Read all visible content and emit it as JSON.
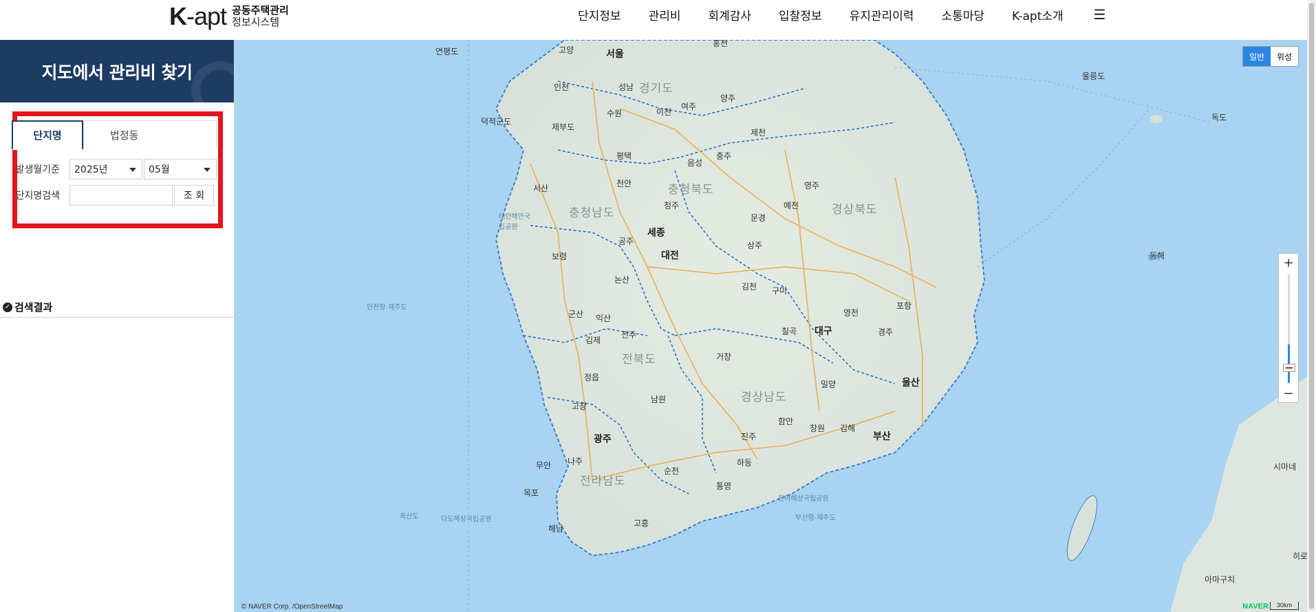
{
  "header": {
    "logo_mark_bold": "K",
    "logo_mark_rest": "-apt",
    "logo_line1": "공동주택관리",
    "logo_line2": "정보시스템",
    "nav": [
      "단지정보",
      "관리비",
      "회계감사",
      "입찰정보",
      "유지관리이력",
      "소통마당",
      "K-apt소개"
    ],
    "menu_icon": "hamburger-icon",
    "menu_glyph": "☰"
  },
  "panel": {
    "title": "지도에서 관리비 찾기",
    "tabs": {
      "active": "단지명",
      "inactive": "법정동"
    },
    "date_label": "발생월기준",
    "year_value": "2025년",
    "month_value": "05월",
    "name_label": "단지명검색",
    "name_value": "",
    "search_button": "조 회",
    "results_label": "검색결과",
    "highlight_color": "#e3161f"
  },
  "map": {
    "type_toggle": {
      "normal": "일반",
      "satellite": "위성"
    },
    "zoom_in": "+",
    "zoom_out": "−",
    "copyright": "© NAVER Corp. /OpenStreetMap",
    "provider": "NAVER",
    "scale": "30km",
    "provinces": [
      "경기도",
      "충청북도",
      "충청남도",
      "경상북도",
      "전북도",
      "경상남도",
      "전라남도"
    ],
    "cities_major": [
      "서울",
      "세종",
      "대전",
      "대구",
      "울산",
      "부산",
      "광주"
    ],
    "cities": [
      "홍천",
      "연평도",
      "고양",
      "인천",
      "성남",
      "수원",
      "이천",
      "여주",
      "양주",
      "덕적군도",
      "제부도",
      "제천",
      "평택",
      "음성",
      "충주",
      "천안",
      "서산",
      "영주",
      "청주",
      "예천",
      "문경",
      "공주",
      "보령",
      "상주",
      "논산",
      "김천",
      "구미",
      "영천",
      "포항",
      "군산",
      "익산",
      "전주",
      "김제",
      "칠곡",
      "경주",
      "거창",
      "정읍",
      "남원",
      "밀양",
      "고창",
      "함안",
      "창원",
      "김해",
      "진주",
      "나주",
      "무안",
      "목포",
      "순천",
      "하동",
      "통영",
      "해남",
      "고흥",
      "동해",
      "독도",
      "울릉도",
      "시마네",
      "아마구치",
      "히로"
    ],
    "sea_labels": [
      "동해",
      "태안해안국립공원",
      "다도해상국립공원",
      "한려해상국립공원",
      "부산항-제주도",
      "인천항-제주도",
      "흑산도"
    ]
  }
}
